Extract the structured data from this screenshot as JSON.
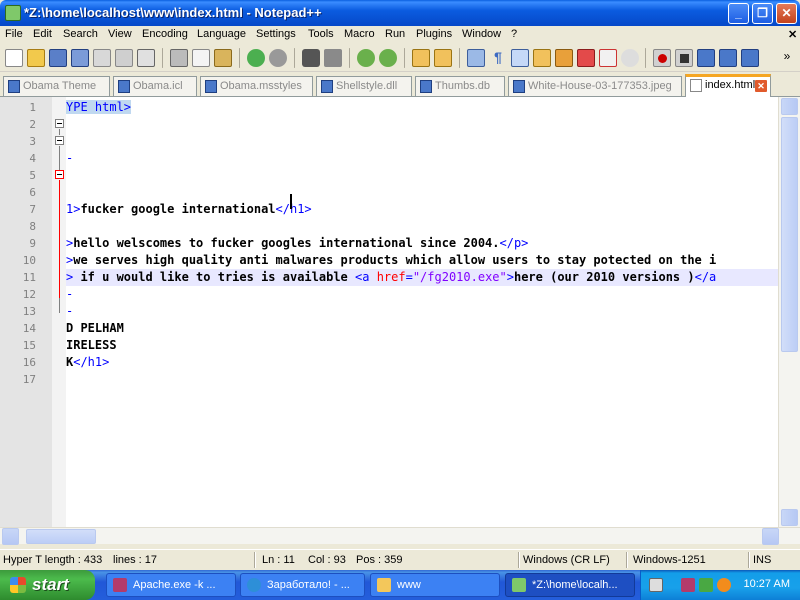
{
  "window": {
    "title": "*Z:\\home\\localhost\\www\\index.html - Notepad++",
    "min_label": "_",
    "max_label": "❐",
    "close_label": "✕"
  },
  "menu": [
    "File",
    "Edit",
    "Search",
    "View",
    "Encoding",
    "Language",
    "Settings",
    "Tools",
    "Macro",
    "Run",
    "Plugins",
    "Window",
    "?"
  ],
  "tabs": [
    {
      "label": "Obama Theme"
    },
    {
      "label": "Obama.icl"
    },
    {
      "label": "Obama.msstyles"
    },
    {
      "label": "Shellstyle.dll"
    },
    {
      "label": "Thumbs.db"
    },
    {
      "label": "White-House-03-177353.jpeg"
    },
    {
      "label": "index.html",
      "close": "✕"
    }
  ],
  "editor": {
    "line_numbers": [
      "1",
      "2",
      "3",
      "4",
      "5",
      "6",
      "7",
      "8",
      "9",
      "10",
      "11",
      "12",
      "13",
      "14",
      "15",
      "16",
      "17"
    ],
    "lines": {
      "l1": "YPE html>",
      "l4": "-",
      "l7a": "1>",
      "l7b": "fucker google international",
      "l7c": "</h1>",
      "l9a": ">",
      "l9b": "hello welscomes to fucker googles international since 2004.",
      "l9c": "</p>",
      "l10a": ">",
      "l10b": "we serves high quality anti malwares products which allow users to stay potected on the i",
      "l11a": "> ",
      "l11b": "if u would like to tries is available ",
      "l11c": "<a ",
      "l11d": "href",
      "l11e": "=",
      "l11f": "\"/fg2010.exe\"",
      "l11g": ">",
      "l11h": "here (our 2010 versions )",
      "l11i": "</a",
      "l12": "-",
      "l13": "-",
      "l14": "D PELHAM",
      "l15": "IRELESS",
      "l16a": "K",
      "l16b": "</h1>"
    }
  },
  "status": {
    "length": "Hyper T length : 433",
    "lines": "lines : 17",
    "ln": "Ln : 11",
    "col": "Col : 93",
    "pos": "Pos : 359",
    "eol": "Windows (CR LF)",
    "encoding": "Windows-1251",
    "mode": "INS"
  },
  "taskbar": {
    "start": "start",
    "buttons": [
      {
        "label": "Apache.exe -k ..."
      },
      {
        "label": "Заработало! - ..."
      },
      {
        "label": "www"
      },
      {
        "label": "*Z:\\home\\localh..."
      }
    ],
    "clock": "10:27 AM"
  },
  "colors": {
    "tag": "#0000ff",
    "attribute": "#ff0000",
    "attr_value": "#8000ff",
    "current_line": "#e8e8ff",
    "active_tab_accent": "#f5a623"
  }
}
